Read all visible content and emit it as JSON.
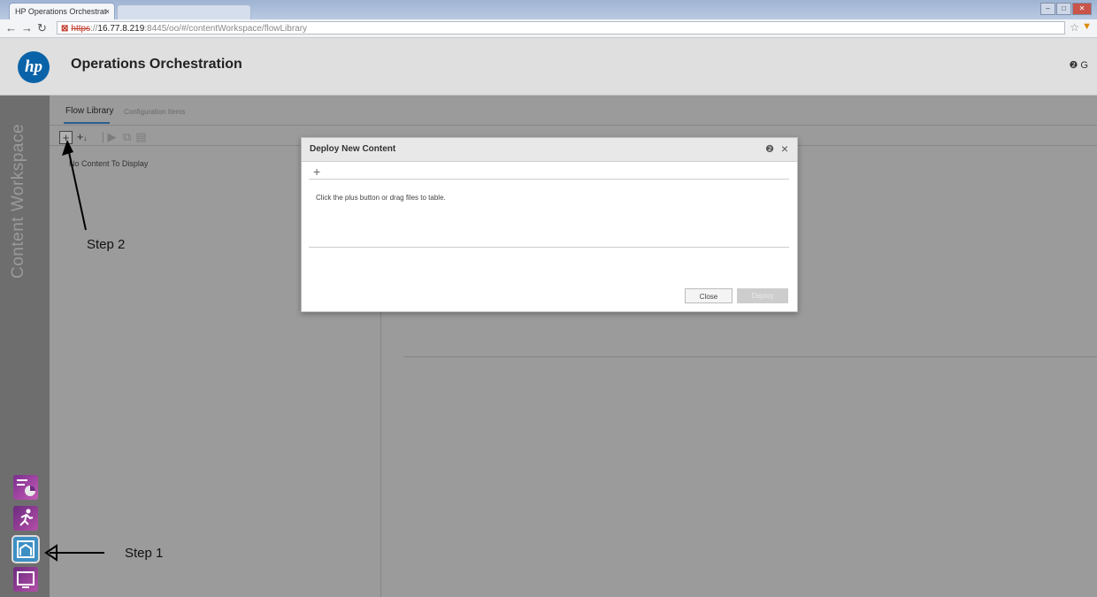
{
  "browser": {
    "tab_title": "HP Operations Orchestrat",
    "tab_close": "×",
    "url_scheme": "https",
    "url_host": "16.77.8.219",
    "url_rest": ":8445/oo/#/contentWorkspace/flowLibrary"
  },
  "app": {
    "logo_text": "hp",
    "title": "Operations Orchestration",
    "header_right": "❷ G"
  },
  "sidebar": {
    "vertical_title": "Content Workspace",
    "nav_icons": [
      "dashboard-icon",
      "run-management-icon",
      "content-workspace-icon",
      "system-configuration-icon"
    ]
  },
  "workspace": {
    "tabs": [
      "Flow Library",
      "Configuration Items"
    ],
    "empty_message": "No Content To Display",
    "toolbar": [
      "add",
      "deploy",
      "run",
      "copy",
      "paste"
    ]
  },
  "annotations": {
    "step1": "Step 1",
    "step2": "Step 2"
  },
  "modal": {
    "title": "Deploy New Content",
    "help": "❷",
    "close_x": "×",
    "plus": "+",
    "hint": "Click the plus button or drag files to table.",
    "close_button": "Close",
    "deploy_button": "Deploy"
  },
  "colors": {
    "hp_blue": "#0a63a8",
    "overlay_gray": "#9b9b9b",
    "sidebar_gray": "#6e6e6e"
  }
}
